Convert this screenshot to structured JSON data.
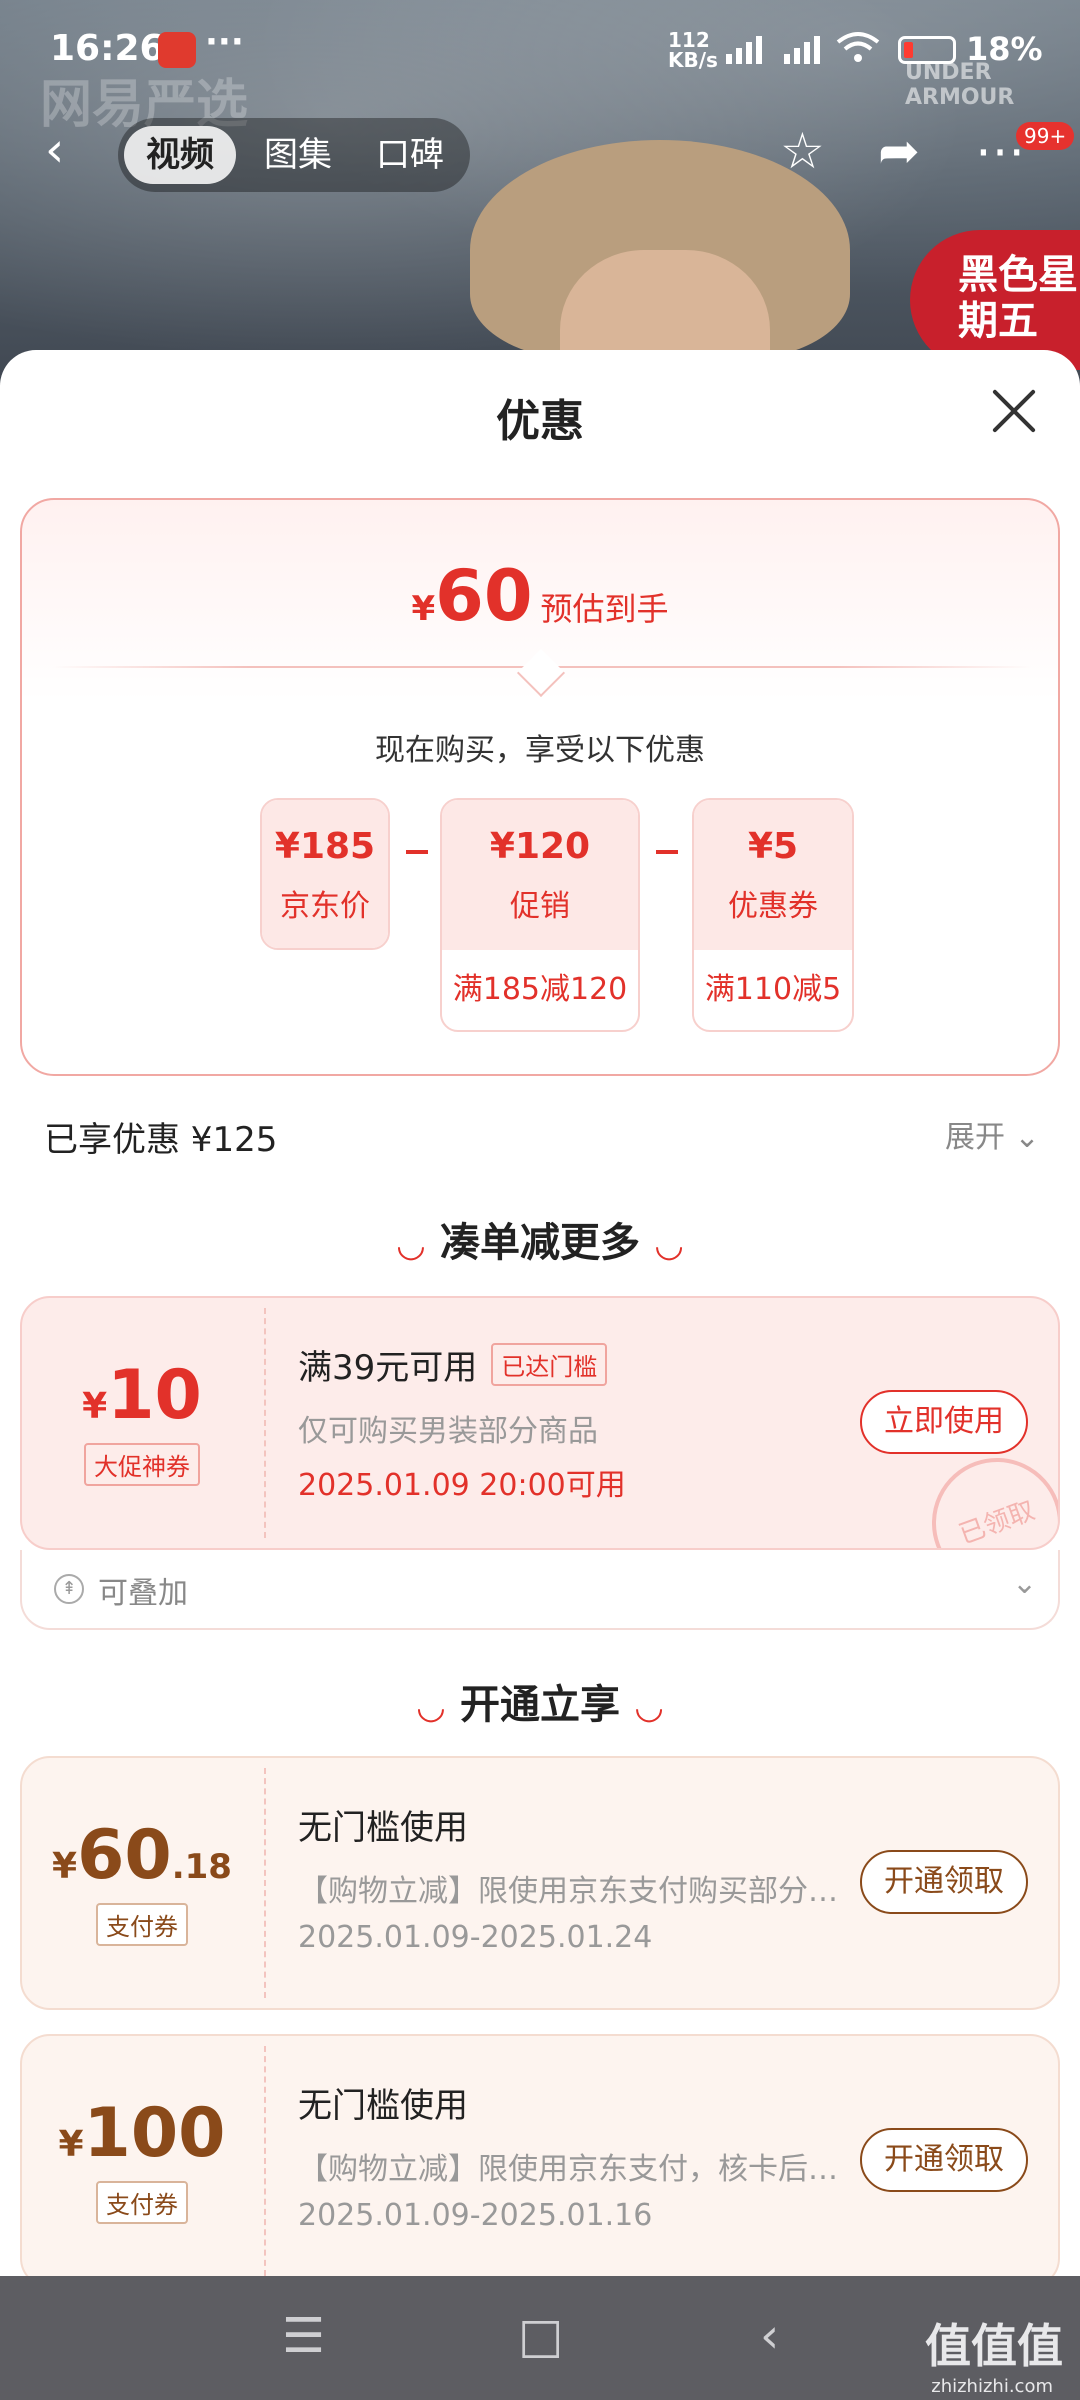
{
  "status_bar": {
    "time": "16:26",
    "more": "···",
    "speed_top": "112",
    "speed_unit": "KB/s",
    "battery": "18%"
  },
  "nav": {
    "back": "‹",
    "tabs": [
      "视频",
      "图集",
      "口碑"
    ],
    "active_tab": 0,
    "badge": "99+",
    "brand_text": "网易严选",
    "promo_text": "黑色星期五",
    "brand_logo_text": "UNDER ARMOUR"
  },
  "sheet": {
    "title": "优惠",
    "estimate": {
      "currency": "¥",
      "amount": "60",
      "label": "预估到手"
    },
    "now_buy": "现在购买，享受以下优惠",
    "breakdown": [
      {
        "value": "¥185",
        "name": "京东价",
        "rule": ""
      },
      {
        "value": "¥120",
        "name": "促销",
        "rule": "满185减120"
      },
      {
        "value": "¥5",
        "name": "优惠券",
        "rule": "满110减5"
      }
    ],
    "enjoyed": "已享优惠 ¥125",
    "expand": "展开",
    "section1": "凑单减更多",
    "coupon1": {
      "currency": "¥",
      "amount": "10",
      "tag": "大促神券",
      "title": "满39元可用",
      "badge": "已达门槛",
      "desc": "仅可购买男装部分商品",
      "date": "2025.01.09 20:00可用",
      "button": "立即使用",
      "stamp": "已领取"
    },
    "stack_label": "可叠加",
    "section2": "开通立享",
    "coupon2": {
      "currency": "¥",
      "amount": "60",
      "decimal": ".18",
      "tag": "支付券",
      "title": "无门槛使用",
      "desc": "【购物立减】限使用京东支付购买部分商品",
      "date": "2025.01.09-2025.01.24",
      "button": "开通领取"
    },
    "coupon3": {
      "currency": "¥",
      "amount": "100",
      "tag": "支付券",
      "title": "无门槛使用",
      "desc": "【购物立减】限使用京东支付，核卡后可用",
      "date": "2025.01.09-2025.01.16",
      "button": "开通领取"
    }
  },
  "system_nav": {
    "menu": "☰",
    "home": "□",
    "back": "‹"
  },
  "watermark": {
    "main": "值值值",
    "sub": "zhizhizhi.com"
  },
  "colors": {
    "accent": "#e2312a",
    "brown": "#8a4a1a",
    "sheet_bg": "#ffffff"
  }
}
